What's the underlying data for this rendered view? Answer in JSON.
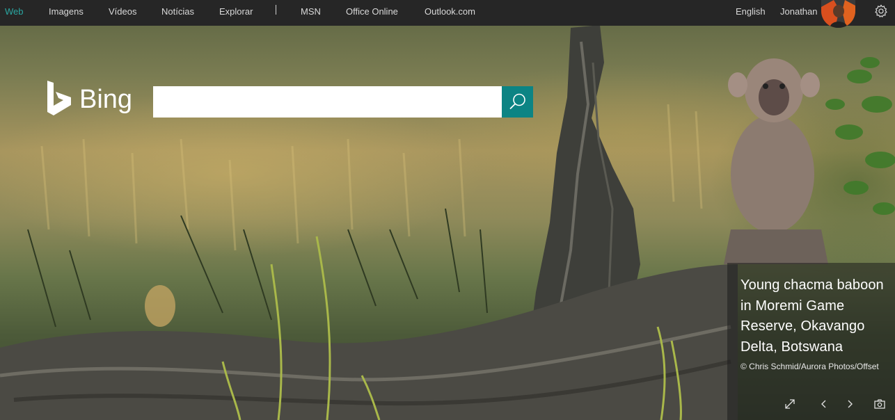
{
  "nav": {
    "links": [
      {
        "label": "Web",
        "active": true
      },
      {
        "label": "Imagens"
      },
      {
        "label": "Vídeos"
      },
      {
        "label": "Notícias"
      },
      {
        "label": "Explorar"
      },
      {
        "label": "MSN"
      },
      {
        "label": "Office Online"
      },
      {
        "label": "Outlook.com"
      }
    ],
    "language": "English",
    "user_name": "Jonathan",
    "icons": {
      "settings": "gear-icon",
      "avatar": "user-avatar"
    }
  },
  "logo": {
    "wordmark": "Bing"
  },
  "search": {
    "value": "",
    "placeholder": "",
    "button_icon": "search-icon"
  },
  "photo": {
    "title": "Young chacma baboon in Moremi Game Reserve, Okavango Delta, Botswana",
    "credit": "© Chris Schmid/Aurora Photos/Offset"
  },
  "image_controls": [
    "fullscreen-icon",
    "chevron-left-icon",
    "chevron-right-icon",
    "camera-icon"
  ],
  "colors": {
    "accent": "#2aa8a3",
    "search_button": "#0c8484",
    "topbar": "#262626"
  }
}
